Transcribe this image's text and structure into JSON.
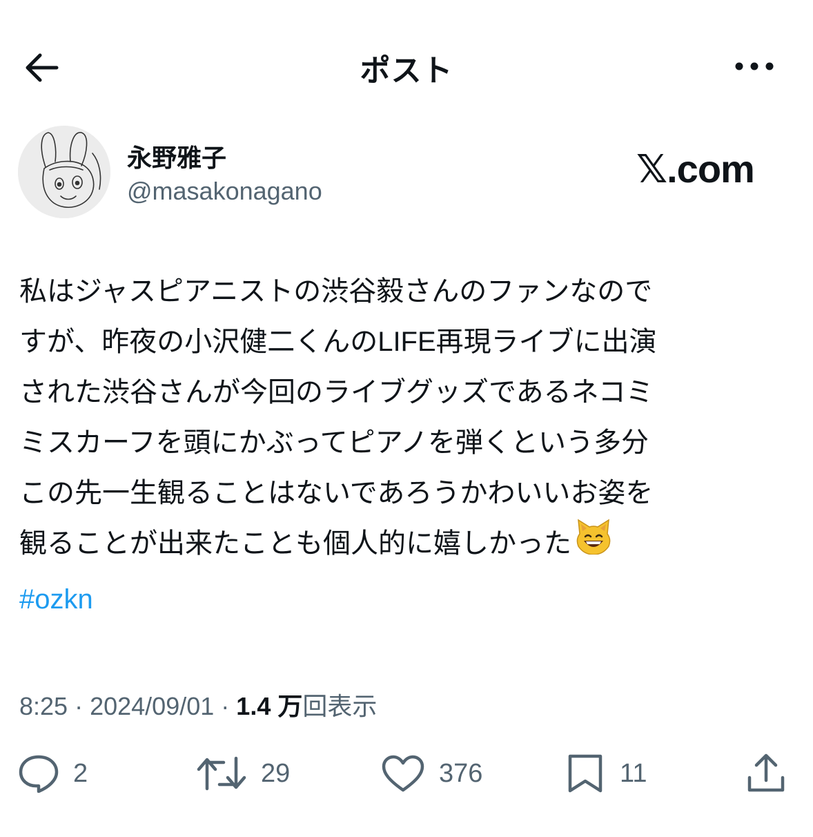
{
  "header": {
    "title": "ポスト"
  },
  "author": {
    "name": "永野雅子",
    "handle": "@masakonagano"
  },
  "brand": "𝕏.com",
  "tweet": {
    "lines": [
      "私はジャスピアニストの渋谷毅さんのファンなので",
      "すが、昨夜の小沢健二くんのLIFE再現ライブに出演",
      "された渋谷さんが今回のライブグッズであるネコミ",
      "ミスカーフを頭にかぶってピアノを弾くという多分",
      "この先一生観ることはないであろうかわいいお姿を",
      "観ることが出来たことも個人的に嬉しかった"
    ],
    "hashtag": "#ozkn"
  },
  "meta": {
    "time": "8:25",
    "date": "2024/09/01",
    "views_count": "1.4 万",
    "views_label": "回表示"
  },
  "actions": {
    "replies": "2",
    "reposts": "29",
    "likes": "376",
    "bookmarks": "11"
  },
  "colors": {
    "text": "#0f1419",
    "secondary": "#536471",
    "link": "#1d9bf0"
  }
}
